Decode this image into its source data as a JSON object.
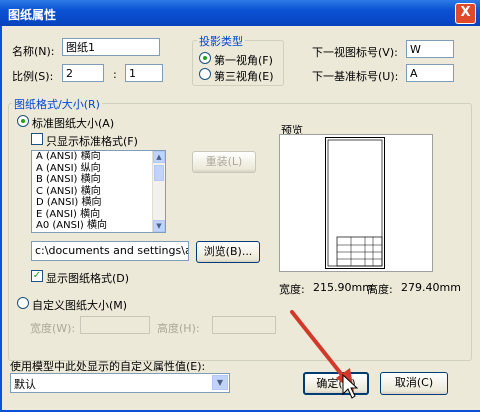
{
  "window": {
    "title": "图纸属性",
    "close_label": "X"
  },
  "fields": {
    "name_label": "名称(N):",
    "name_value": "图纸1",
    "scale_label": "比例(S):",
    "scale_a": "2",
    "scale_sep": ":",
    "scale_b": "1",
    "next_view_label": "下一视图标号(V):",
    "next_view_value": "W",
    "next_datum_label": "下一基准标号(U):",
    "next_datum_value": "A"
  },
  "projection": {
    "title": "投影类型",
    "first_angle": "第一视角(F)",
    "third_angle": "第三视角(E)"
  },
  "format": {
    "title": "图纸格式/大小(R)",
    "standard_label": "标准图纸大小(A)",
    "only_standard_label": "只显示标准格式(F)",
    "sizes": [
      "A (ANSI) 横向",
      "A (ANSI) 纵向",
      "B (ANSI) 横向",
      "C (ANSI) 横向",
      "D (ANSI) 横向",
      "E (ANSI) 横向",
      "A0 (ANSI) 横向"
    ],
    "reload_label": "重装(L)",
    "path_value": "c:\\documents and settings\\all",
    "browse_label": "浏览(B)...",
    "show_format_label": "显示图纸格式(D)",
    "custom_label": "自定义图纸大小(M)",
    "width_label": "宽度(W):",
    "height_label": "高度(H):"
  },
  "preview": {
    "title": "预览",
    "width_label": "宽度:",
    "width_value": "215.90mm",
    "height_label": "高度:",
    "height_value": "279.40mm"
  },
  "custom_prop": {
    "label": "使用模型中此处显示的自定义属性值(E):",
    "value": "默认"
  },
  "buttons": {
    "ok": "确定(O)",
    "cancel": "取消(C)"
  },
  "colors": {
    "accent": "#0a52d4",
    "annotation_arrow": "#d2392b"
  }
}
